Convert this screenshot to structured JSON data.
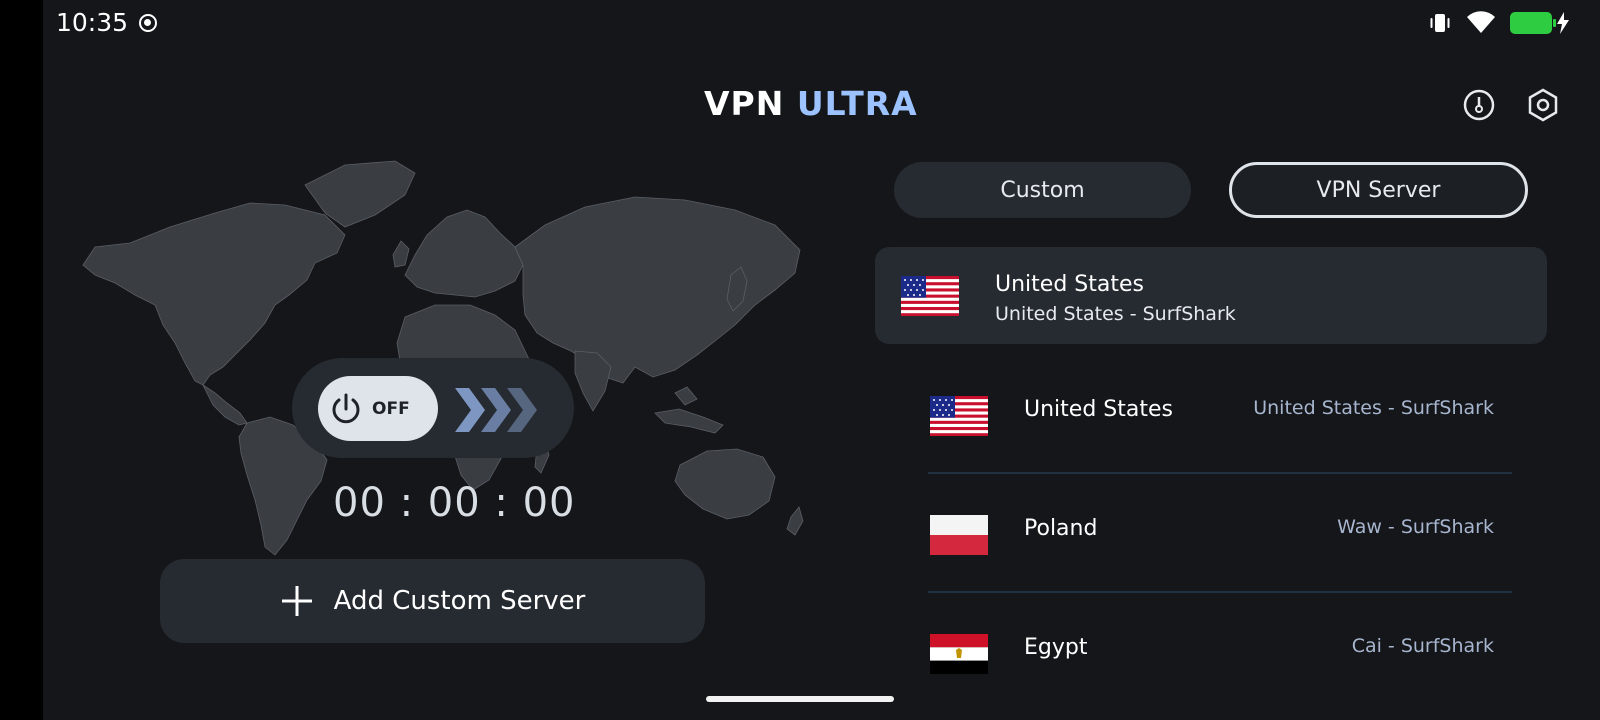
{
  "status_bar": {
    "time": "10:35"
  },
  "app": {
    "title_part1": "VPN",
    "title_part2": "ULTRA"
  },
  "power": {
    "state_label": "OFF",
    "timer": "00 : 00 : 00"
  },
  "add_server": {
    "label": "Add Custom Server"
  },
  "tabs": [
    {
      "label": "Custom",
      "active": false
    },
    {
      "label": "VPN Server",
      "active": true
    }
  ],
  "selected_server": {
    "country": "United States",
    "subtitle": "United States - SurfShark",
    "flag": "us-flag"
  },
  "servers": [
    {
      "country": "United States",
      "location": "United States - SurfShark",
      "flag": "us-flag"
    },
    {
      "country": "Poland",
      "location": "Waw - SurfShark",
      "flag": "poland-flag"
    },
    {
      "country": "Egypt",
      "location": "Cai - SurfShark",
      "flag": "egypt-flag"
    }
  ],
  "colors": {
    "background": "#141619",
    "card": "#262a31",
    "accent": "#9cc2ff",
    "battery": "#2ecc40",
    "secondary_text": "#a7b5cf"
  }
}
